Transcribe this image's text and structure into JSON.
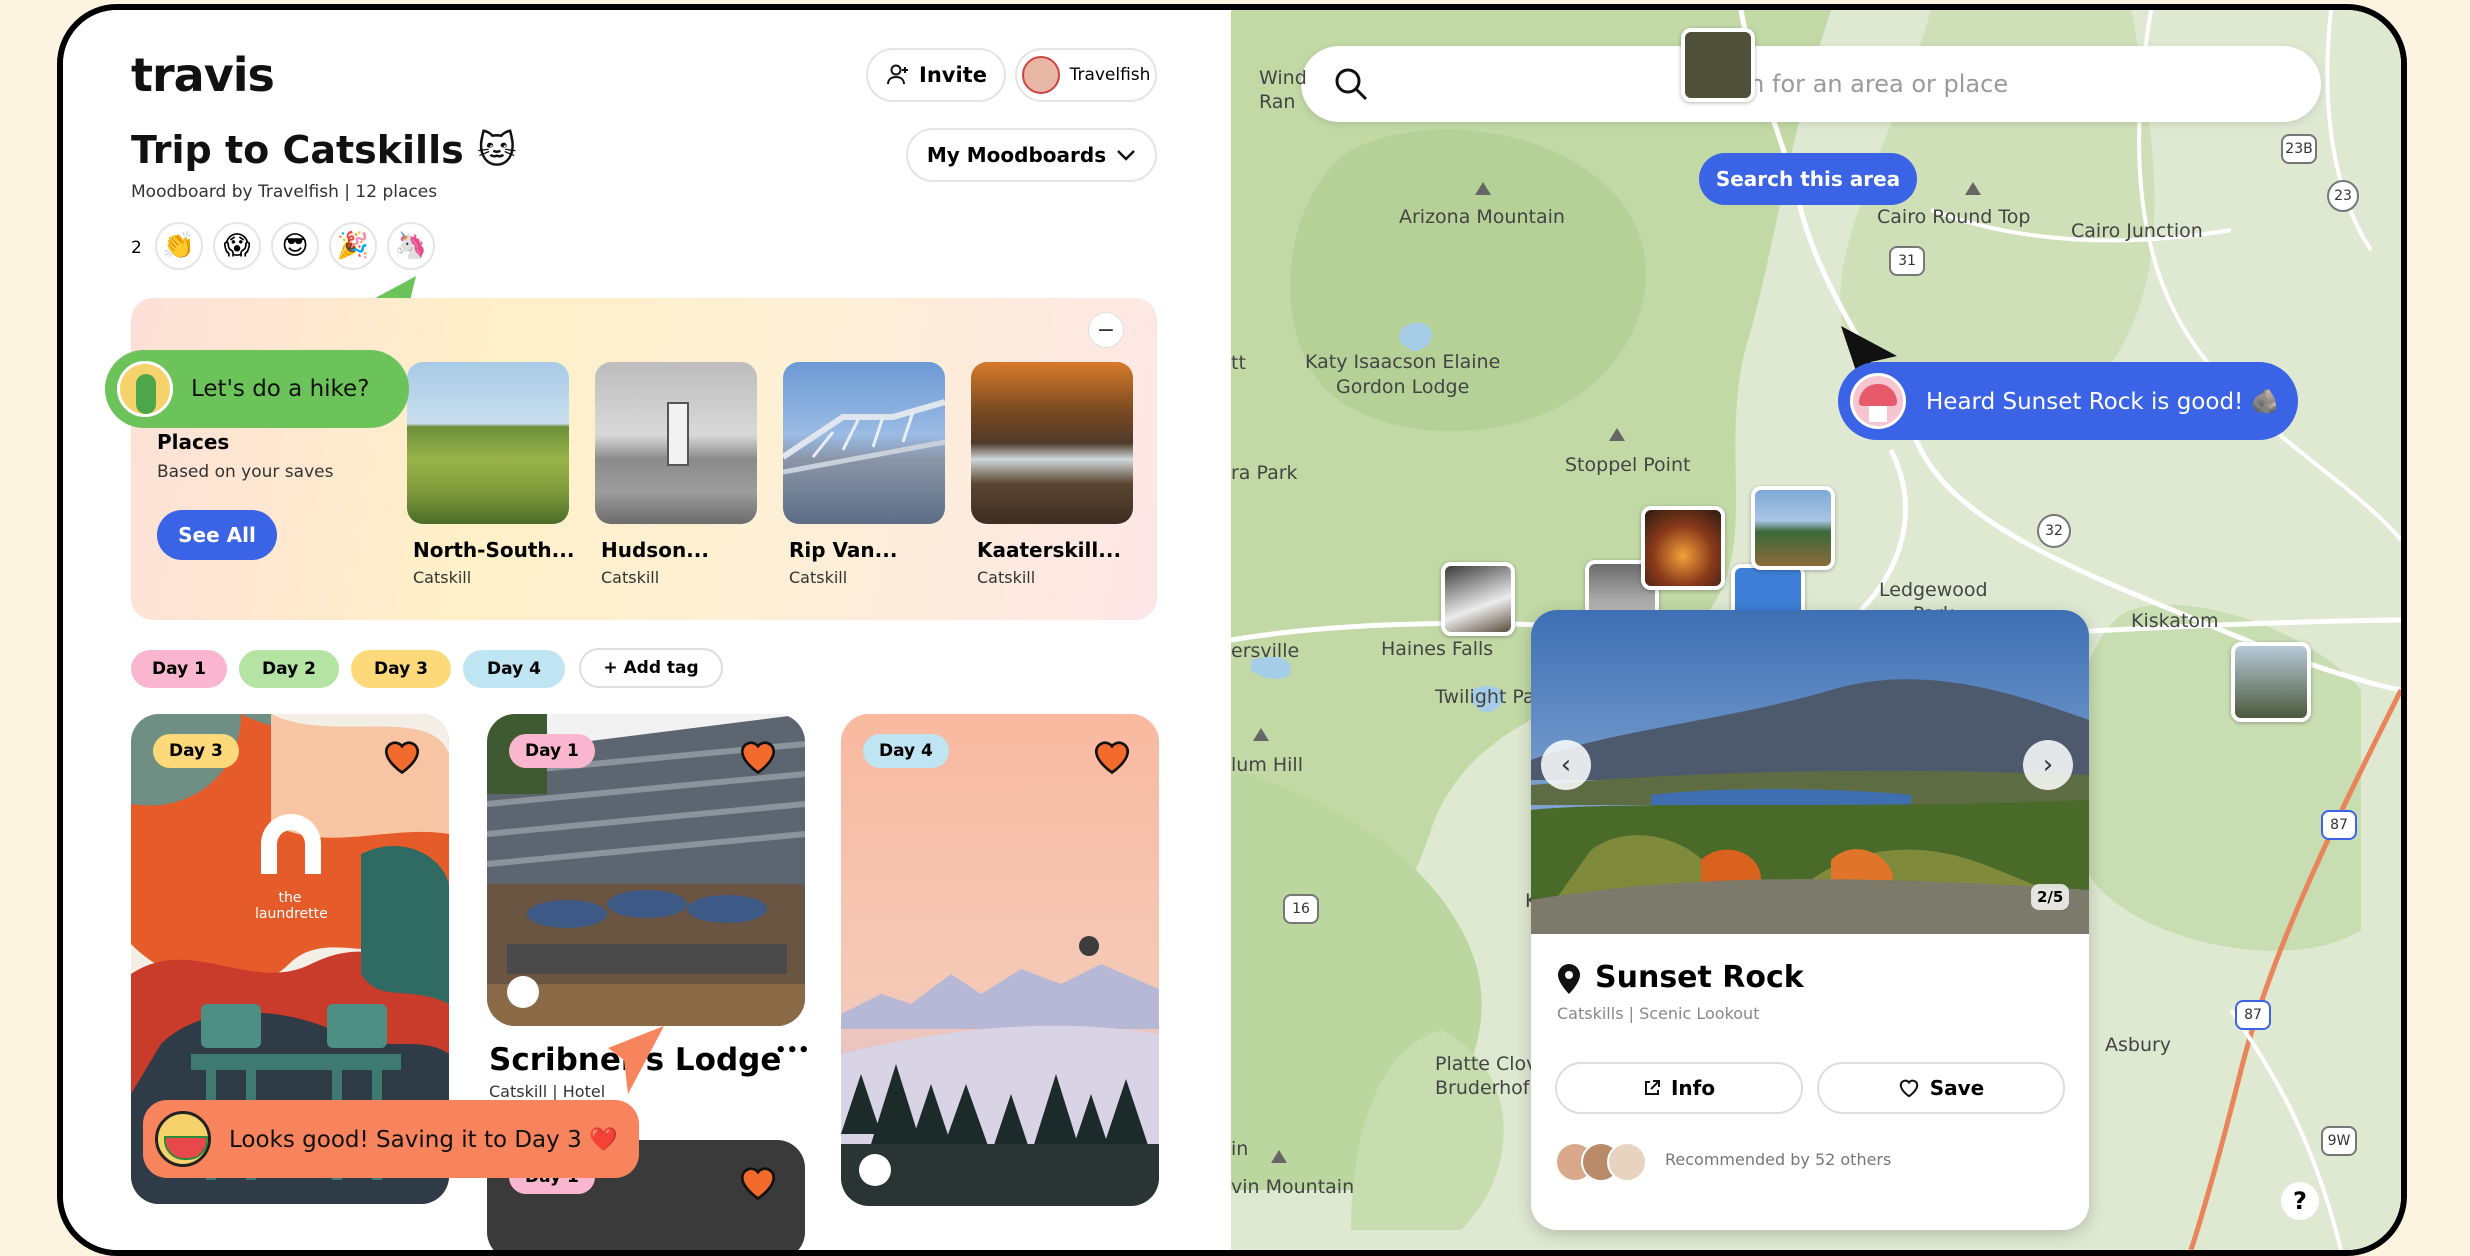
{
  "header": {
    "logo_text": "travis",
    "invite_label": "Invite",
    "user_label": "Travelfish",
    "moodboards_label": "My Moodboards"
  },
  "trip": {
    "title": "Trip to Catskills 🐱",
    "subtitle": "Moodboard by Travelfish | 12 places",
    "reaction_count": "2",
    "reactions": [
      "👏",
      "😱",
      "😎",
      "🎉",
      "🦄"
    ]
  },
  "suggestions": {
    "heading": "Places",
    "subheading": "Based on your saves",
    "see_all_label": "See All",
    "collapse_label": "−",
    "places": [
      {
        "name": "North-South...",
        "city": "Catskill"
      },
      {
        "name": "Hudson...",
        "city": "Catskill"
      },
      {
        "name": "Rip Van...",
        "city": "Catskill"
      },
      {
        "name": "Kaaterskill...",
        "city": "Catskill"
      }
    ]
  },
  "tags": {
    "items": [
      "Day 1",
      "Day 2",
      "Day 3",
      "Day 4"
    ],
    "add_label": "+ Add tag",
    "colors": [
      "#fbb6cf",
      "#b5e3a3",
      "#fdd97a",
      "#bfe4f2"
    ]
  },
  "cards": {
    "card1_day": "Day 3",
    "card1_art_text": "the laundrette",
    "card2_day": "Day 1",
    "card2_name": "Scribner's Lodge",
    "card2_sub": "Catskill | Hotel",
    "card2_more": "•••",
    "card3_day": "Day 4",
    "card4_day": "Day 1"
  },
  "chat": {
    "green_msg": "Let's do a hike?",
    "orange_msg": "Looks good! Saving it to Day 3 ❤️",
    "blue_msg": "Heard Sunset Rock is good! 🪨"
  },
  "map": {
    "search_placeholder": "Search for an area or place",
    "search_area_label": "Search this area",
    "labels": {
      "arizona": "Arizona Mountain",
      "cairo_top": "Cairo Round Top",
      "cairo_jct": "Cairo Junction",
      "katy": "Katy Isaacson Elaine\nGordon Lodge",
      "stoppel": "Stoppel Point",
      "ledgewood": "Ledgewood\nPark",
      "kiskatom": "Kiskatom",
      "haines": "Haines Falls",
      "twilight": "Twilight Pa",
      "hill": "lum Hill",
      "ersville": "ersville",
      "park": "ra Park",
      "wind": "Wind\nRan",
      "platte": "Platte Clov\nBruderhof",
      "asbury": "Asbury",
      "vin": "vin Mountain",
      "in": "in",
      "ka": "Ka",
      "tt": "tt"
    },
    "shields": [
      "23B",
      "23",
      "31",
      "32",
      "16",
      "87",
      "87",
      "9W"
    ],
    "help_label": "?"
  },
  "popup": {
    "title": "Sunset Rock",
    "subtitle": "Catskills | Scenic Lookout",
    "counter": "2/5",
    "info_label": "Info",
    "save_label": "Save",
    "recommended": "Recommended by 52 others"
  },
  "colors": {
    "accent_blue": "#3a63e6",
    "heart": "#f26b2c",
    "bubble_green": "#6cc35a",
    "bubble_orange": "#f7845c"
  }
}
